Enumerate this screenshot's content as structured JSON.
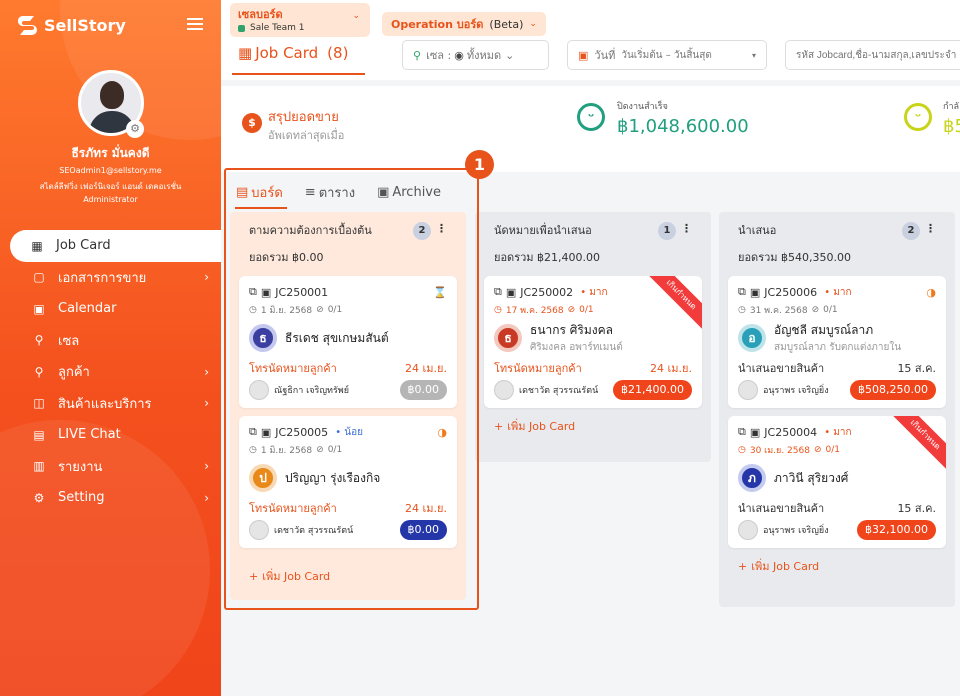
{
  "brand": {
    "name": "SellStory"
  },
  "user": {
    "name": "ธีรภัทร มั่นคงดี",
    "email": "SEOadmin1@sellstory.me",
    "company": "สไตล์ลีฟวิ่ง เฟอร์นิเจอร์ แอนด์ เดคอเรชั่น",
    "role": "Administrator"
  },
  "nav": [
    {
      "label": "Job Card",
      "icon": "grid-icon"
    },
    {
      "label": "เอกสารการขาย",
      "icon": "document-icon",
      "chevron": "›"
    },
    {
      "label": "Calendar",
      "icon": "calendar-icon"
    },
    {
      "label": "เซล",
      "icon": "person-icon"
    },
    {
      "label": "ลูกค้า",
      "icon": "customer-icon",
      "chevron": "›"
    },
    {
      "label": "สินค้าและบริการ",
      "icon": "bag-icon",
      "chevron": "›"
    },
    {
      "label": "LIVE Chat",
      "icon": "chat-icon"
    },
    {
      "label": "รายงาน",
      "icon": "report-icon",
      "chevron": "›"
    },
    {
      "label": "Setting",
      "icon": "gear-icon",
      "chevron": "›"
    }
  ],
  "top": {
    "board_label": "เซลบอร์ด",
    "team": "Sale Team 1",
    "op_board": "Operation บอร์ด",
    "beta": "(Beta)",
    "page_title": "Job Card",
    "count": "(8)",
    "sale_filter": "เซล :",
    "sale_all": "ทั้งหมด",
    "date_label": "วันที่",
    "date_range": "วันเริ่มต้น – วันสิ้นสุด",
    "search_placeholder": "รหัส Jobcard,ชื่อ-นามสกุล,เลขประจำ"
  },
  "summary": {
    "title": "สรุปยอดขาย",
    "subtitle": "อัพเดทล่าสุดเมื่อ",
    "kpi1_label": "ปิดงานสำเร็จ",
    "kpi1_value": "฿1,048,600.00",
    "kpi2_label": "กำลั",
    "kpi2_value": "฿5"
  },
  "annotation": "1",
  "tabs": [
    "บอร์ด",
    "ตาราง",
    "Archive"
  ],
  "add_label": "เพิ่ม Job Card",
  "columns": [
    {
      "title": "ตามความต้องการเบื้องต้น",
      "count": "2",
      "total": "ยอดรวม ฿0.00",
      "bg": "#ffe9dc",
      "cards": [
        {
          "code": "JC250001",
          "priority": "",
          "date": "1 มิ.ย. 2568",
          "tasks": "0/1",
          "cust_initial": "ธ",
          "cust": "ธีรเดช สุขเกษมสันต์",
          "cust_sub": "",
          "stage": "โทรนัดหมายลูกค้า",
          "stage_date": "24 เม.ย.",
          "owner": "ณัฐธิกา เจริญทรัพย์",
          "amount": "฿0.00"
        },
        {
          "code": "JC250005",
          "priority": "• น้อย",
          "date": "1 มิ.ย. 2568",
          "tasks": "0/1",
          "cust_initial": "ป",
          "cust": "ปริญญา รุ่งเรืองกิจ",
          "cust_sub": "",
          "stage": "โทรนัดหมายลูกค้า",
          "stage_date": "24 เม.ย.",
          "owner": "เดชาวัต สุวรรณรัตน์",
          "amount": "฿0.00"
        }
      ]
    },
    {
      "title": "นัดหมายเพื่อนำเสนอ",
      "count": "1",
      "total": "ยอดรวม ฿21,400.00",
      "bg": "#e9eaee",
      "cards": [
        {
          "code": "JC250002",
          "priority": "• มาก",
          "date": "17 พ.ค. 2568",
          "tasks": "0/1",
          "cust_initial": "ธ",
          "cust": "ธนากร ศิริมงคล",
          "cust_sub": "ศิริมงคล อพาร์ทเมนต์",
          "stage": "โทรนัดหมายลูกค้า",
          "stage_date": "24 เม.ย.",
          "owner": "เดชาวัต สุวรรณรัตน์",
          "amount": "฿21,400.00",
          "ribbon": "เกินกำหนด"
        }
      ]
    },
    {
      "title": "นำเสนอ",
      "count": "2",
      "total": "ยอดรวม ฿540,350.00",
      "bg": "#e9eaee",
      "cards": [
        {
          "code": "JC250006",
          "priority": "• มาก",
          "date": "31 พ.ค. 2568",
          "tasks": "0/1",
          "cust_initial": "อ",
          "cust": "อัญชลี สมบูรณ์ลาภ",
          "cust_sub": "สมบูรณ์ลาภ รับตกแต่งภายใน",
          "stage": "นำเสนอขายสินค้า",
          "stage_date": "15 ส.ค.",
          "owner": "อนุราพร เจริญยิ่ง",
          "amount": "฿508,250.00"
        },
        {
          "code": "JC250004",
          "priority": "• มาก",
          "date": "30 เม.ย. 2568",
          "tasks": "0/1",
          "cust_initial": "ภ",
          "cust": "ภาวินี สุริยวงศ์",
          "cust_sub": "",
          "stage": "นำเสนอขายสินค้า",
          "stage_date": "15 ส.ค.",
          "owner": "อนุราพร เจริญยิ่ง",
          "amount": "฿32,100.00",
          "ribbon": "เกินกำหนด"
        }
      ]
    }
  ]
}
